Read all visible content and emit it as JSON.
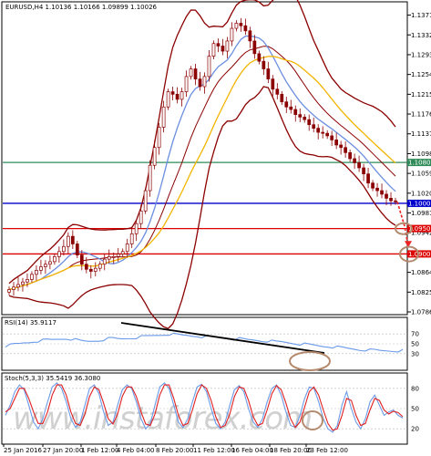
{
  "chart_data": {
    "type": "candlestick",
    "symbol_header": "EURUSD,H4  1.10136 1.10166 1.09899 1.10026",
    "y_ticks": [
      "1.13710",
      "1.13320",
      "1.12930",
      "1.12540",
      "1.12150",
      "1.11760",
      "1.11370",
      "1.10980",
      "1.10590",
      "1.10200",
      "1.09810",
      "1.09420",
      "1.09030",
      "1.08640",
      "1.08250",
      "1.07860"
    ],
    "x_ticks": [
      "25 Jan 2016",
      "27 Jan 20:00",
      "1 Feb 12:00",
      "4 Feb 04:00",
      "8 Feb 20:00",
      "11 Feb 12:00",
      "16 Feb 04:00",
      "18 Feb 20:00",
      "23 Feb 12:00"
    ],
    "price_lines": [
      {
        "value": 1.10806,
        "label": "1.10806",
        "color": "#2e8b57"
      },
      {
        "value": 1.1,
        "label": "1.10000",
        "color": "#0000cc"
      },
      {
        "value": 1.09503,
        "label": "1.09503",
        "color": "#dd0000"
      },
      {
        "value": 1.09003,
        "label": "1.09003",
        "color": "#dd0000"
      }
    ],
    "price_range": [
      1.0786,
      1.139
    ],
    "close_path": [
      1.083,
      1.0835,
      1.084,
      1.0845,
      1.085,
      1.086,
      1.0868,
      1.0875,
      1.088,
      1.0885,
      1.0895,
      1.0905,
      1.0915,
      1.0935,
      1.092,
      1.0898,
      1.088,
      1.087,
      1.0866,
      1.0872,
      1.088,
      1.089,
      1.0895,
      1.0895,
      1.09,
      1.0905,
      1.092,
      1.094,
      1.096,
      1.0985,
      1.1025,
      1.1075,
      1.111,
      1.115,
      1.119,
      1.122,
      1.1215,
      1.1205,
      1.122,
      1.125,
      1.1265,
      1.1245,
      1.123,
      1.125,
      1.129,
      1.1315,
      1.131,
      1.13,
      1.132,
      1.1345,
      1.1355,
      1.135,
      1.134,
      1.132,
      1.1295,
      1.128,
      1.1265,
      1.1245,
      1.1225,
      1.1215,
      1.12,
      1.119,
      1.1185,
      1.1175,
      1.117,
      1.1165,
      1.1155,
      1.1148,
      1.114,
      1.1138,
      1.1133,
      1.1125,
      1.1115,
      1.111,
      1.11,
      1.1088,
      1.108,
      1.107,
      1.1058,
      1.104,
      1.103,
      1.1025,
      1.1018,
      1.101,
      1.1005,
      1.1003
    ],
    "rsi": {
      "label": "RSI(14) 35.9117",
      "levels": [
        "70",
        "50",
        "30"
      ],
      "values": [
        46,
        47,
        49,
        50,
        52,
        53,
        55,
        56,
        57,
        58,
        58,
        59,
        60,
        61,
        60,
        58,
        56,
        55,
        55,
        56,
        57,
        59,
        60,
        61,
        60,
        60,
        61,
        62,
        63,
        64,
        65,
        66,
        67,
        68,
        69,
        70,
        69,
        68,
        67,
        67,
        66,
        66,
        65,
        64,
        64,
        63,
        62,
        62,
        61,
        60,
        60,
        59,
        58,
        58,
        57,
        56,
        56,
        55,
        54,
        54,
        53,
        52,
        51,
        50,
        49,
        48,
        47,
        46,
        45,
        45,
        44,
        43,
        42,
        41,
        40,
        39,
        38,
        38,
        37,
        37,
        36,
        36,
        36,
        36,
        36,
        36
      ]
    },
    "stoch": {
      "label": "Stoch(5,3,3) 35.5419 36.3080",
      "levels": [
        "80",
        "50",
        "20"
      ],
      "main": [
        40,
        55,
        75,
        85,
        78,
        55,
        30,
        20,
        35,
        60,
        82,
        88,
        80,
        60,
        35,
        22,
        30,
        55,
        80,
        85,
        72,
        45,
        25,
        30,
        55,
        78,
        85,
        80,
        60,
        35,
        20,
        28,
        55,
        82,
        88,
        80,
        55,
        30,
        22,
        35,
        60,
        82,
        86,
        75,
        50,
        28,
        20,
        30,
        55,
        78,
        84,
        75,
        50,
        30,
        22,
        35,
        60,
        80,
        85,
        70,
        45,
        25,
        22,
        40,
        65,
        82,
        80,
        60,
        35,
        20,
        15,
        25,
        55,
        75,
        50,
        30,
        20,
        35,
        60,
        70,
        55,
        40,
        45,
        48,
        40,
        36
      ],
      "signal": [
        45,
        50,
        65,
        80,
        80,
        65,
        45,
        28,
        28,
        45,
        70,
        85,
        85,
        70,
        45,
        28,
        25,
        42,
        68,
        82,
        78,
        58,
        35,
        27,
        42,
        68,
        82,
        82,
        68,
        45,
        27,
        25,
        42,
        70,
        85,
        85,
        65,
        40,
        25,
        28,
        48,
        72,
        85,
        80,
        62,
        38,
        22,
        25,
        42,
        68,
        82,
        80,
        62,
        38,
        25,
        28,
        48,
        72,
        84,
        78,
        58,
        35,
        22,
        30,
        52,
        75,
        82,
        70,
        48,
        28,
        18,
        20,
        40,
        65,
        62,
        40,
        25,
        28,
        48,
        65,
        62,
        48,
        42,
        46,
        44,
        38
      ]
    }
  },
  "watermark": "www.instaforex.com",
  "colors": {
    "candle": "#8b0000",
    "bb": "#8b0000",
    "ma_fast": "#6b8ee0",
    "ma_slow": "#f2b400",
    "rsi": "#6a9ae8",
    "stoch_main": "#6a9ae8",
    "stoch_signal": "#e02020",
    "circle": "#b48a6e",
    "arrow": "#ee2222"
  }
}
